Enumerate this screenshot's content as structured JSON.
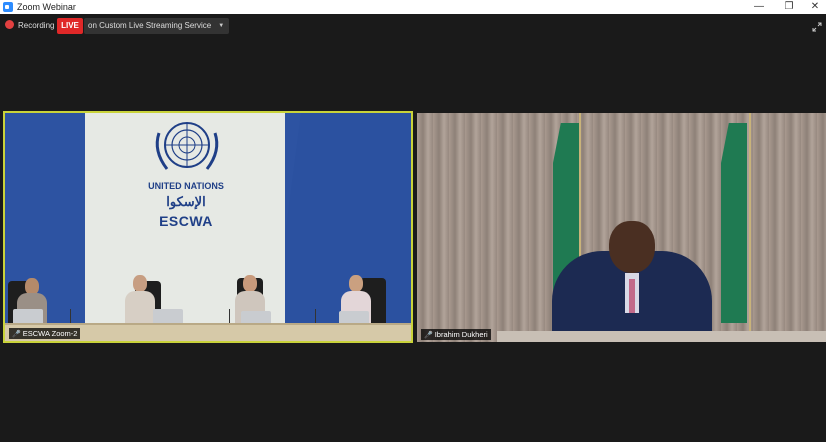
{
  "window": {
    "title": "Zoom Webinar",
    "minimize": "—",
    "maximize": "❐",
    "close": "✕"
  },
  "toolbar": {
    "recording_label": "Recording",
    "live_label": "LIVE",
    "stream_label": "on Custom Live Streaming Service",
    "stream_chevron": "▼"
  },
  "tiles": [
    {
      "name": "ESCWA Zoom-2",
      "signage": {
        "line1": "UNITED NATIONS",
        "line2": "الإسكوا",
        "line3": "ESCWA"
      }
    },
    {
      "name": "Ibrahim Dukheri"
    }
  ],
  "colors": {
    "active_speaker_border": "#c9d33a",
    "live_badge": "#e02828",
    "recording_dot": "#e24040"
  }
}
